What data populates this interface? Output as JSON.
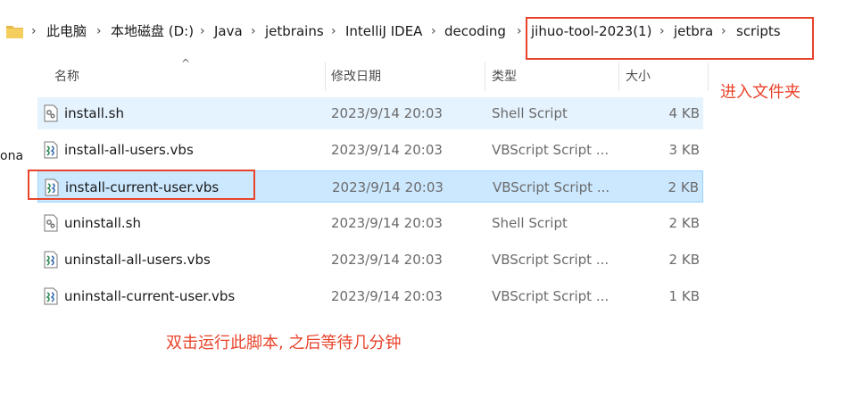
{
  "breadcrumb": {
    "items": [
      "此电脑",
      "本地磁盘 (D:)",
      "Java",
      "jetbrains",
      "IntelliJ IDEA",
      "decoding",
      "jihuo-tool-2023(1)",
      "jetbra",
      "scripts"
    ]
  },
  "columns": {
    "name": "名称",
    "modified": "修改日期",
    "type": "类型",
    "size": "大小"
  },
  "files": [
    {
      "name": "install.sh",
      "date": "2023/9/14 20:03",
      "type": "Shell Script",
      "size": "4 KB",
      "icon": "shell-script-file-icon"
    },
    {
      "name": "install-all-users.vbs",
      "date": "2023/9/14 20:03",
      "type": "VBScript Script ...",
      "size": "3 KB",
      "icon": "vbscript-file-icon"
    },
    {
      "name": "install-current-user.vbs",
      "date": "2023/9/14 20:03",
      "type": "VBScript Script ...",
      "size": "2 KB",
      "icon": "vbscript-file-icon"
    },
    {
      "name": "uninstall.sh",
      "date": "2023/9/14 20:03",
      "type": "Shell Script",
      "size": "2 KB",
      "icon": "shell-script-file-icon"
    },
    {
      "name": "uninstall-all-users.vbs",
      "date": "2023/9/14 20:03",
      "type": "VBScript Script ...",
      "size": "2 KB",
      "icon": "vbscript-file-icon"
    },
    {
      "name": "uninstall-current-user.vbs",
      "date": "2023/9/14 20:03",
      "type": "VBScript Script ...",
      "size": "1 KB",
      "icon": "vbscript-file-icon"
    }
  ],
  "sidebar_fragment": "ona",
  "annotations": {
    "enter_folder": "进入文件夹",
    "run_script": "双击运行此脚本, 之后等待几分钟",
    "color": "#e8432b"
  },
  "colors": {
    "selected_bg": "#cce8ff",
    "hover_bg": "#e5f3ff"
  }
}
